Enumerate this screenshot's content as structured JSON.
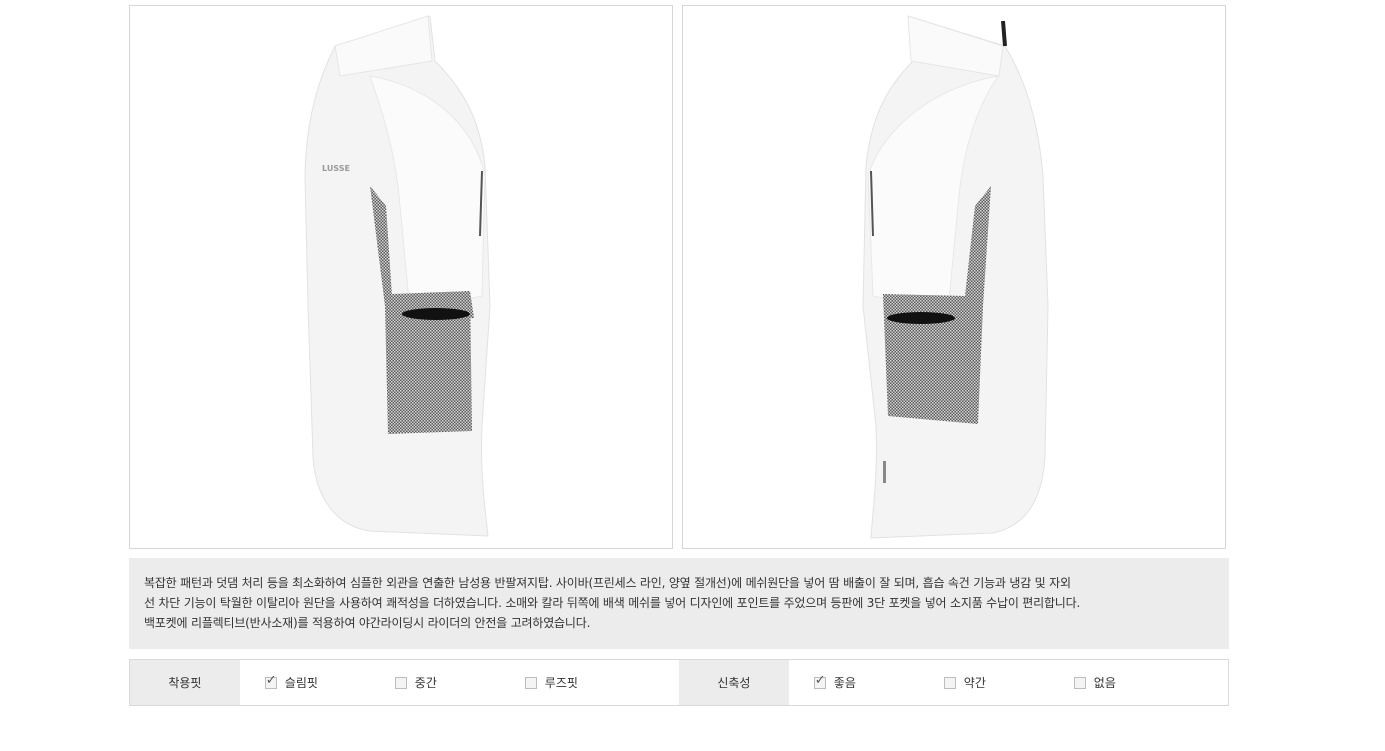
{
  "description": {
    "line1": "복잡한 패턴과 덧댐 처리 등을 최소화하여 심플한 외관을 연출한 남성용 반팔져지탑. 사이바(프린세스 라인, 양옆 절개선)에 메쉬원단을 넣어 땀 배출이 잘 되며, 흡습 속건 기능과 냉감 및 자외",
    "line2": "선 차단 기능이 탁월한 이탈리아 원단을 사용하여 쾌적성을 더하였습니다. 소매와 칼라 뒤쪽에 배색 메쉬를 넣어 디자인에 포인트를 주었으며 등판에 3단 포켓을 넣어 소지품 수납이 편리합니다.",
    "line3": "백포켓에 리플렉티브(반사소재)를 적용하여 야간라이딩시 라이더의 안전을 고려하였습니다."
  },
  "fit": {
    "label": "착용핏",
    "options": [
      {
        "label": "슬림핏",
        "checked": true
      },
      {
        "label": "중간",
        "checked": false
      },
      {
        "label": "루즈핏",
        "checked": false
      }
    ]
  },
  "stretch": {
    "label": "신축성",
    "options": [
      {
        "label": "좋음",
        "checked": true
      },
      {
        "label": "약간",
        "checked": false
      },
      {
        "label": "없음",
        "checked": false
      }
    ]
  },
  "logo_text": "LUSSE",
  "check_glyph": "✓"
}
